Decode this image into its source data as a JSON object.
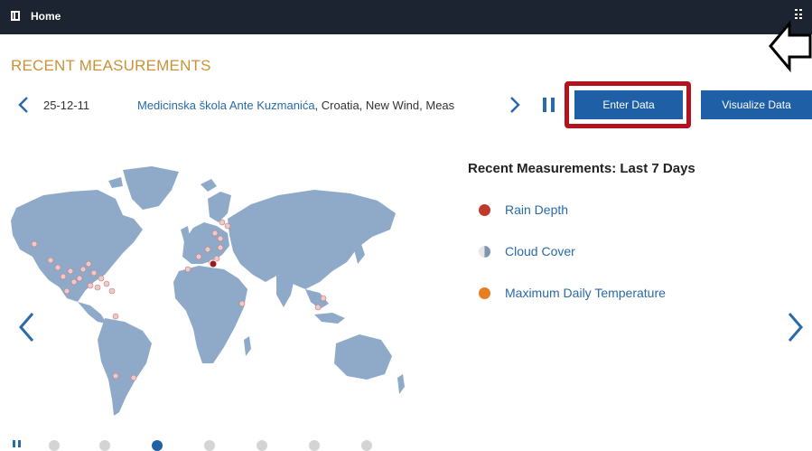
{
  "topbar": {
    "home_label": "Home",
    "home_icon": "sidebar-icon",
    "grid_icon": "apps-icon"
  },
  "section": {
    "title": "RECENT MEASUREMENTS"
  },
  "measurement": {
    "date": "25-12-11",
    "school": "Medicinska škola Ante Kuzmanića",
    "country": ", Croatia, ",
    "measure": "New Wind, Meas"
  },
  "buttons": {
    "enter": "Enter Data",
    "visualize": "Visualize Data"
  },
  "legend": {
    "title": "Recent Measurements:  Last 7 Days",
    "items": [
      {
        "label": "Rain Depth",
        "color": "#c0392b"
      },
      {
        "label": "Cloud Cover",
        "color": "#7f94b0"
      },
      {
        "label": "Maximum Daily Temperature",
        "color": "#e67e22"
      }
    ]
  },
  "colors": {
    "accent": "#1f5fa6",
    "title": "#c8923a",
    "link": "#2a6aa8",
    "land": "#8fa9c9",
    "highlight": "#b3121f"
  },
  "pager": {
    "count": 7,
    "active_index": 2
  }
}
